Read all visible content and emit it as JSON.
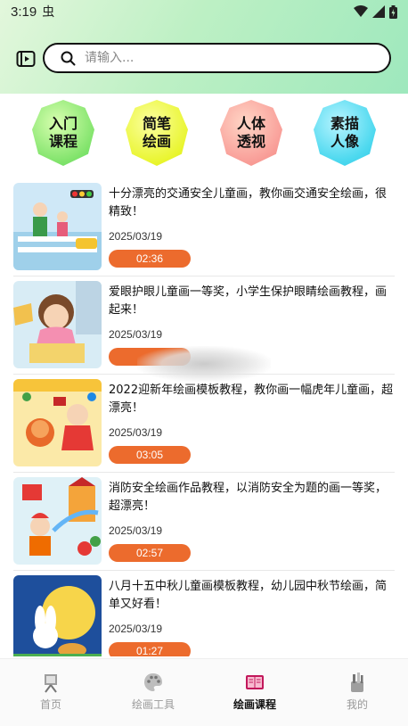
{
  "status": {
    "time": "3:19",
    "bug_glyph": "虫"
  },
  "search": {
    "placeholder": "请输入..."
  },
  "categories": [
    {
      "label": "入门课程"
    },
    {
      "label": "简笔绘画"
    },
    {
      "label": "人体透视"
    },
    {
      "label": "素描人像"
    }
  ],
  "courses": [
    {
      "title": "十分漂亮的交通安全儿童画，教你画交通安全绘画，很精致！",
      "date": "2025/03/19",
      "duration": "02:36"
    },
    {
      "title": "爱眼护眼儿童画一等奖，小学生保护眼睛绘画教程，画起来！",
      "date": "2025/03/19",
      "duration": ""
    },
    {
      "title": "2022迎新年绘画模板教程，教你画一幅虎年儿童画，超漂亮！",
      "date": "2025/03/19",
      "duration": "03:05"
    },
    {
      "title": "消防安全绘画作品教程，以消防安全为题的画一等奖，超漂亮！",
      "date": "2025/03/19",
      "duration": "02:57"
    },
    {
      "title": "八月十五中秋儿童画模板教程，幼儿园中秋节绘画，简单又好看！",
      "date": "2025/03/19",
      "duration": "01:27"
    }
  ],
  "tabs": [
    {
      "label": "首页"
    },
    {
      "label": "绘画工具"
    },
    {
      "label": "绘画课程"
    },
    {
      "label": "我的"
    }
  ],
  "colors": {
    "accent": "#ec6b2d",
    "header_green": "#9ee8bd"
  }
}
